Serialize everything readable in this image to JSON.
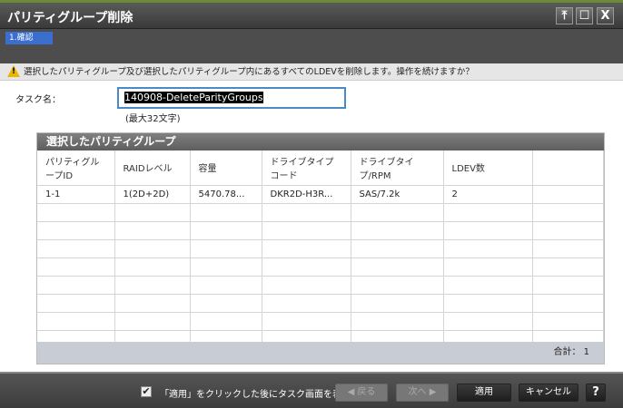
{
  "window": {
    "title": "パリティグループ削除",
    "pin": "⤒",
    "maximize": "☐",
    "close": "X"
  },
  "steps": [
    {
      "label": "1.確認",
      "active": true
    }
  ],
  "warning": {
    "icon": "warning-icon",
    "text": "選択したパリティグループ及び選択したパリティグループ内にあるすべてのLDEVを削除します。操作を続けますか？"
  },
  "task": {
    "label": "タスク名：",
    "value": "140908-DeleteParityGroups",
    "hint": "(最大32文字)"
  },
  "table": {
    "title": "選択したパリティグループ",
    "columns": [
      "パリティグループID",
      "RAIDレベル",
      "容量",
      "ドライブタイプコード",
      "ドライブタイプ/RPM",
      "LDEV数",
      ""
    ],
    "rows": [
      [
        "1-1",
        "1(2D+2D)",
        "5470.78...",
        "DKR2D-H3R...",
        "SAS/7.2k",
        "2",
        ""
      ]
    ],
    "total": "合計：  1"
  },
  "footer": {
    "checkbox_checked": true,
    "checkbox_label": "「適用」をクリックした後にタスク画面を表示",
    "back": "◀ 戻る",
    "next": "次へ ▶",
    "apply": "適用",
    "cancel": "キャンセル",
    "help": "?"
  }
}
